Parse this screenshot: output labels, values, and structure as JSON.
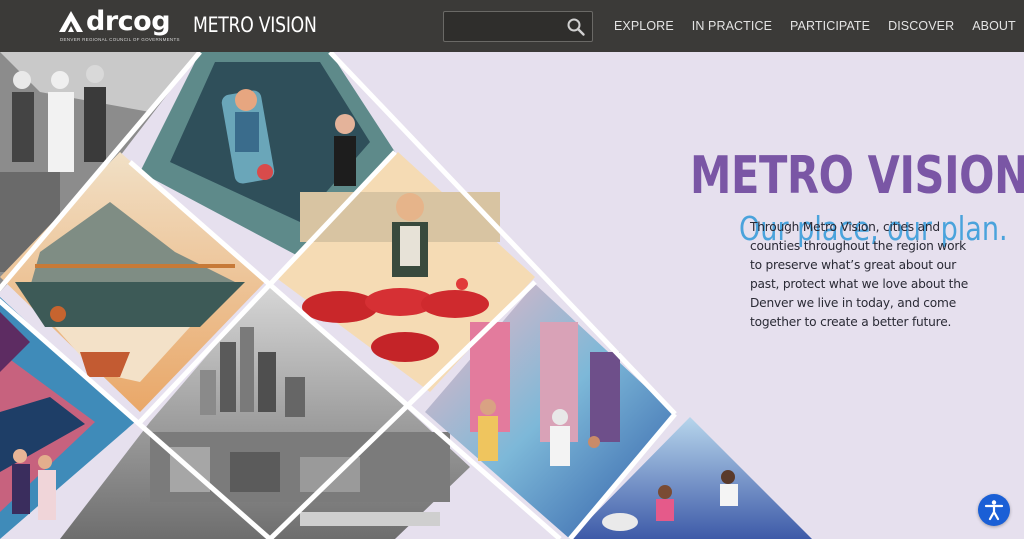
{
  "header": {
    "logo_text": "drcog",
    "logo_tagline": "DENVER REGIONAL COUNCIL OF GOVERNMENTS",
    "site_title": "METRO VISION",
    "search": {
      "placeholder": "",
      "value": "",
      "icon": "search-icon"
    },
    "nav": [
      {
        "label": "EXPLORE"
      },
      {
        "label": "IN PRACTICE"
      },
      {
        "label": "PARTICIPATE"
      },
      {
        "label": "DISCOVER"
      },
      {
        "label": "ABOUT"
      }
    ]
  },
  "hero": {
    "title": "METRO VISION",
    "subtitle": "Our place, our plan.",
    "body": "Through Metro Vision, cities and counties throughout the region work to preserve what’s great about our past, protect what we love about the Denver we live in today, and come together to create a better future."
  },
  "accessibility_button": {
    "icon": "accessibility-icon"
  },
  "colors": {
    "header_bg": "#3b3a38",
    "hero_bg": "#e6e0ee",
    "title": "#7a56a5",
    "subtitle": "#4aa3dc",
    "a11y": "#1a5fd6"
  }
}
